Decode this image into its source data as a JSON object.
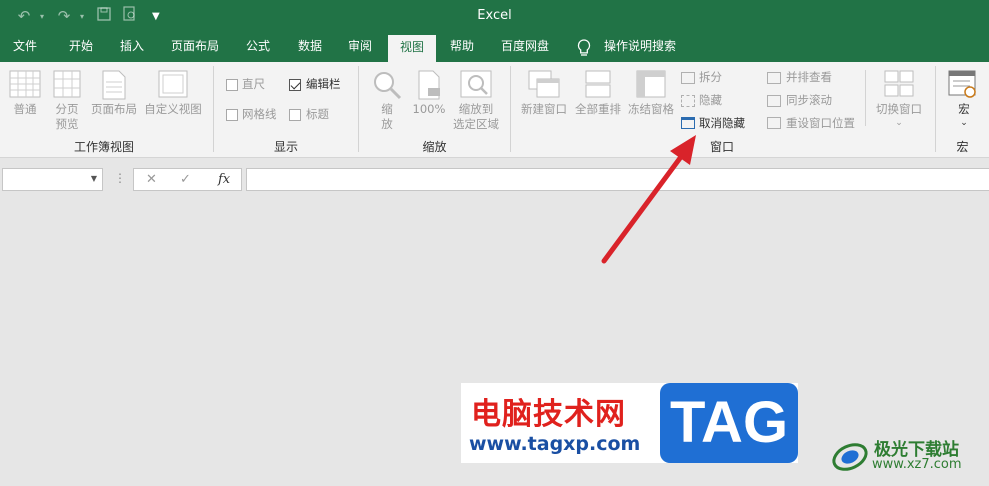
{
  "title_bar": {
    "app_title": "Excel"
  },
  "quick_access": {
    "undo_icon": "undo-icon",
    "redo_icon": "redo-icon",
    "save_icon": "save-icon",
    "print_preview_icon": "print-preview-icon",
    "customize_icon": "customize-qat-icon"
  },
  "tabs": [
    "文件",
    "开始",
    "插入",
    "页面布局",
    "公式",
    "数据",
    "审阅",
    "视图",
    "帮助",
    "百度网盘"
  ],
  "active_tab": "视图",
  "tell_me": "操作说明搜索",
  "ribbon": {
    "workbook_views": {
      "label": "工作簿视图",
      "normal": "普通",
      "page_break_1": "分页",
      "page_break_2": "预览",
      "page_layout": "页面布局",
      "custom_views": "自定义视图"
    },
    "show": {
      "label": "显示",
      "ruler": "直尺",
      "ruler_checked": false,
      "formula_bar": "编辑栏",
      "formula_bar_checked": true,
      "gridlines": "网格线",
      "gridlines_checked": false,
      "headings": "标题",
      "headings_checked": false
    },
    "zoom": {
      "label": "缩放",
      "zoom_1": "缩",
      "zoom_2": "放",
      "hundred": "100%",
      "zoom_sel_1": "缩放到",
      "zoom_sel_2": "选定区域"
    },
    "window": {
      "label": "窗口",
      "new_window": "新建窗口",
      "arrange_all": "全部重排",
      "freeze_panes": "冻结窗格",
      "split": "拆分",
      "hide": "隐藏",
      "unhide": "取消隐藏",
      "view_side_by_side": "并排查看",
      "sync_scrolling": "同步滚动",
      "reset_position": "重设窗口位置",
      "switch_windows": "切换窗口"
    },
    "macros": {
      "label": "宏",
      "button": "宏"
    }
  },
  "formula_bar": {
    "name_box_value": "",
    "cancel": "✕",
    "enter": "✓",
    "fx": "fx",
    "formula_value": ""
  },
  "watermark": {
    "site_name": "电脑技术网",
    "site_url": "www.tagxp.com",
    "tag": "TAG",
    "site2_name": "极光下载站",
    "site2_url": "www.xz7.com"
  },
  "colors": {
    "excel_green": "#217346",
    "arrow_red": "#d9232a",
    "tag_blue": "#1f6fd4"
  }
}
